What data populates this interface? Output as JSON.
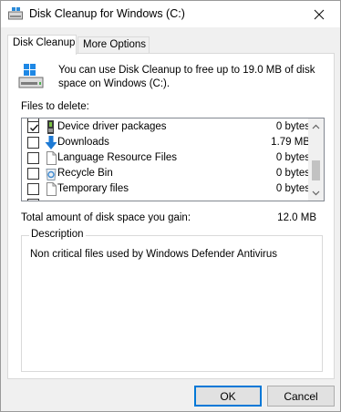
{
  "window": {
    "title": "Disk Cleanup for Windows (C:)",
    "close_icon": "close-icon"
  },
  "tabs": [
    {
      "label": "Disk Cleanup",
      "active": true
    },
    {
      "label": "More Options",
      "active": false
    }
  ],
  "intro": {
    "text": "You can use Disk Cleanup to free up to 19.0 MB of disk space on Windows (C:).",
    "icon": "disk-cleanup-drive-icon"
  },
  "files": {
    "label": "Files to delete:",
    "items": [
      {
        "name": "Device driver packages",
        "size": "0 bytes",
        "checked": true,
        "icon": "driver-package-icon"
      },
      {
        "name": "Downloads",
        "size": "1.79 MB",
        "checked": false,
        "icon": "downloads-arrow-icon"
      },
      {
        "name": "Language Resource Files",
        "size": "0 bytes",
        "checked": false,
        "icon": "blank-file-icon"
      },
      {
        "name": "Recycle Bin",
        "size": "0 bytes",
        "checked": false,
        "icon": "recycle-bin-icon"
      },
      {
        "name": "Temporary files",
        "size": "0 bytes",
        "checked": false,
        "icon": "blank-file-icon"
      }
    ]
  },
  "total": {
    "label": "Total amount of disk space you gain:",
    "value": "12.0 MB"
  },
  "description": {
    "title": "Description",
    "text": "Non critical files used by Windows Defender Antivirus"
  },
  "buttons": {
    "ok": "OK",
    "cancel": "Cancel"
  },
  "colors": {
    "accent": "#0078d7",
    "downloads_arrow": "#1e7ad4"
  }
}
